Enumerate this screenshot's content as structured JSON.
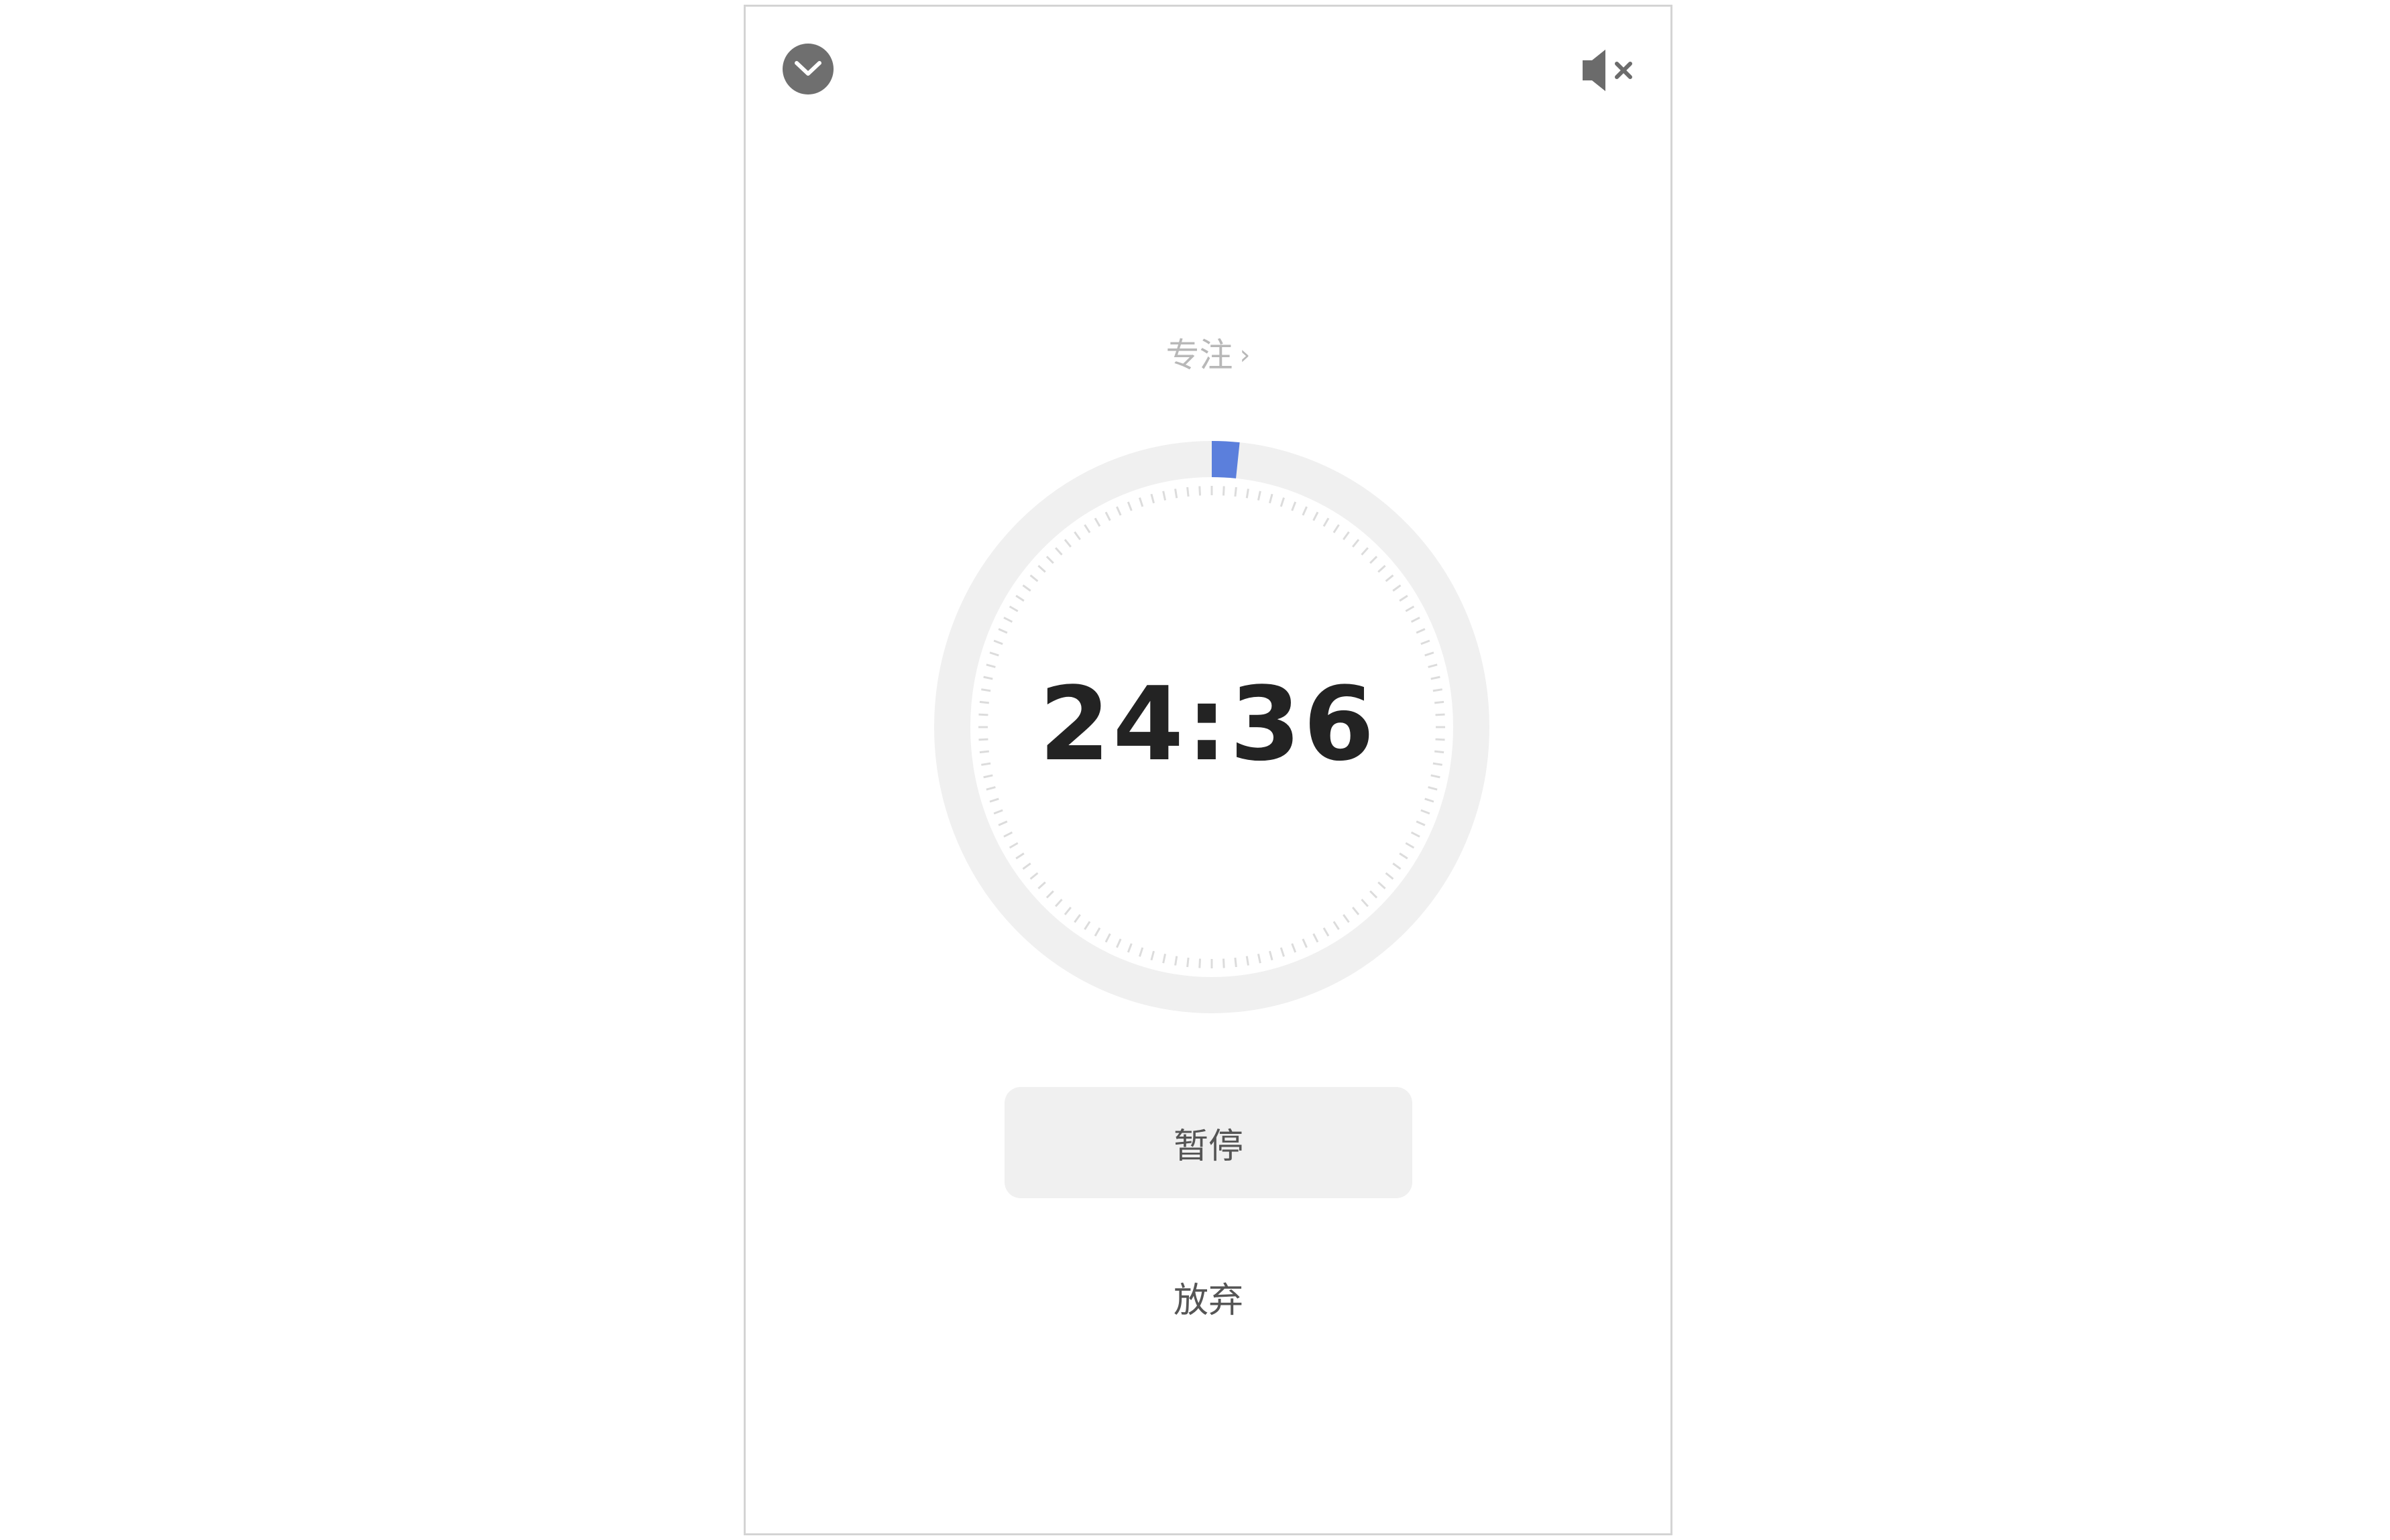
{
  "header": {
    "collapse_icon": "chevron-down-icon",
    "mute_icon": "speaker-muted-icon"
  },
  "timer": {
    "mode_label": "专注",
    "mode_chevron": "›",
    "time_remaining": "24:36",
    "progress_fraction": 0.016,
    "tick_count": 120,
    "progress_color": "#5b7fdc",
    "track_color": "#f0f0f0",
    "tick_color": "#dcdcdc"
  },
  "actions": {
    "pause_label": "暂停",
    "abandon_label": "放弃"
  }
}
